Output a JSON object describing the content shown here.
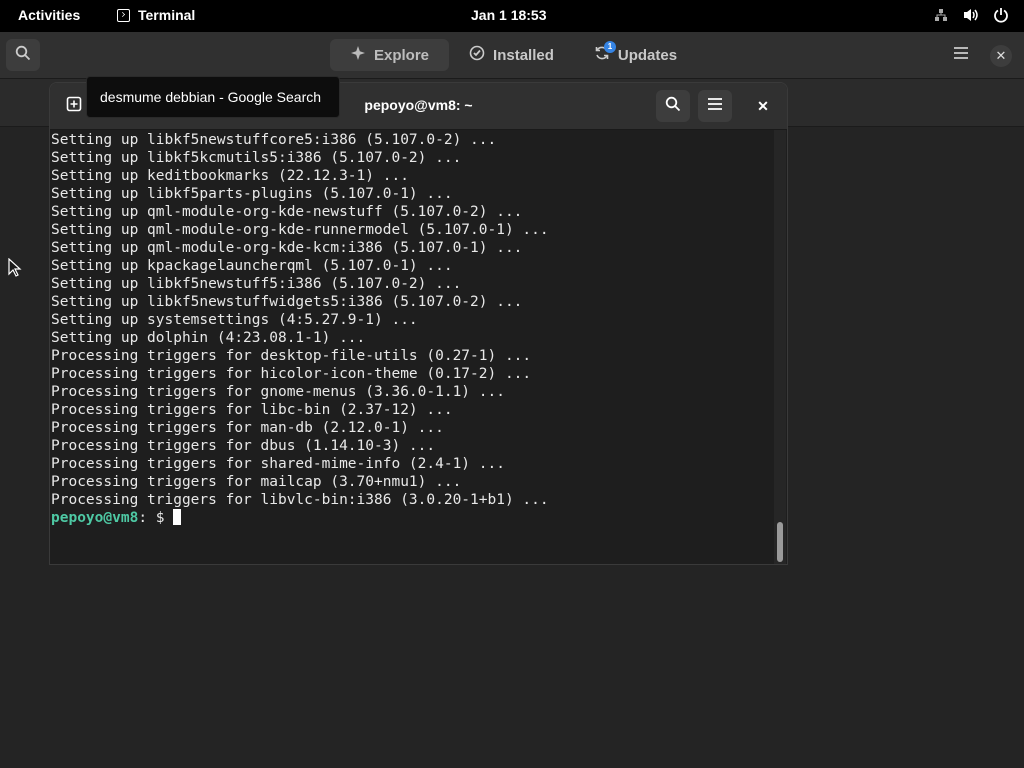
{
  "topbar": {
    "activities": "Activities",
    "app_name": "Terminal",
    "clock": "Jan 1  18:53",
    "tray_icons": [
      "network-icon",
      "volume-icon",
      "power-icon"
    ]
  },
  "software": {
    "tabs": [
      {
        "label": "Explore",
        "icon": "explore-icon",
        "active": true
      },
      {
        "label": "Installed",
        "icon": "installed-icon",
        "active": false
      },
      {
        "label": "Updates",
        "icon": "updates-icon",
        "active": false
      }
    ],
    "updates_badge": "1"
  },
  "tooltip": {
    "text": "desmume debbian - Google Search"
  },
  "terminal": {
    "title": "pepoyo@vm8: ~",
    "lines": [
      "Setting up libkf5newstuffcore5:i386 (5.107.0-2) ...",
      "Setting up libkf5kcmutils5:i386 (5.107.0-2) ...",
      "Setting up keditbookmarks (22.12.3-1) ...",
      "Setting up libkf5parts-plugins (5.107.0-1) ...",
      "Setting up qml-module-org-kde-newstuff (5.107.0-2) ...",
      "Setting up qml-module-org-kde-runnermodel (5.107.0-1) ...",
      "Setting up qml-module-org-kde-kcm:i386 (5.107.0-1) ...",
      "Setting up kpackagelauncherqml (5.107.0-1) ...",
      "Setting up libkf5newstuff5:i386 (5.107.0-2) ...",
      "Setting up libkf5newstuffwidgets5:i386 (5.107.0-2) ...",
      "Setting up systemsettings (4:5.27.9-1) ...",
      "Setting up dolphin (4:23.08.1-1) ...",
      "Processing triggers for desktop-file-utils (0.27-1) ...",
      "Processing triggers for hicolor-icon-theme (0.17-2) ...",
      "Processing triggers for gnome-menus (3.36.0-1.1) ...",
      "Processing triggers for libc-bin (2.37-12) ...",
      "Processing triggers for man-db (2.12.0-1) ...",
      "Processing triggers for dbus (1.14.10-3) ...",
      "Processing triggers for shared-mime-info (2.4-1) ...",
      "Processing triggers for mailcap (3.70+nmu1) ...",
      "Processing triggers for libvlc-bin:i386 (3.0.20-1+b1) ..."
    ],
    "prompt_user": "pepoyo@vm8",
    "prompt_rest": ": $ "
  },
  "colors": {
    "prompt": "#4ec9a4",
    "badge": "#3584e4"
  }
}
